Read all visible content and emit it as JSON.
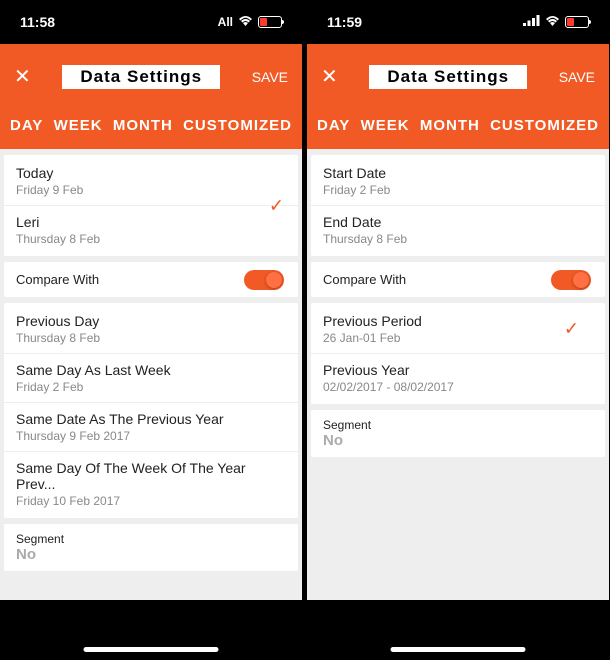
{
  "accent": "#f15a24",
  "left": {
    "status_time": "11:58",
    "carrier": "All",
    "header": {
      "title": "Data Settings",
      "save": "SAVE"
    },
    "tabs": [
      "DAY",
      "WEEK",
      "MONTH",
      "CUSTOMIZED"
    ],
    "options": [
      {
        "title": "Today",
        "sub": "Friday 9 Feb",
        "selected": true
      },
      {
        "title": "Leri",
        "sub": "Thursday 8 Feb",
        "selected": false
      }
    ],
    "compare_label": "Compare With",
    "compare_on": true,
    "compare_options": [
      {
        "title": "Previous Day",
        "sub": "Thursday 8 Feb"
      },
      {
        "title": "Same Day As Last Week",
        "sub": "Friday 2 Feb"
      },
      {
        "title": "Same Date As The Previous Year",
        "sub": "Thursday 9 Feb 2017"
      },
      {
        "title": "Same Day Of The Week Of The Year Prev...",
        "sub": "Friday 10 Feb 2017"
      }
    ],
    "segment": {
      "label": "Segment",
      "value": "No"
    }
  },
  "right": {
    "status_time": "11:59",
    "header": {
      "title": "Data Settings",
      "save": "SAVE"
    },
    "tabs": [
      "DAY",
      "WEEK",
      "MONTH",
      "CUSTOMIZED"
    ],
    "date_range": [
      {
        "title": "Start Date",
        "sub": "Friday 2 Feb"
      },
      {
        "title": "End Date",
        "sub": "Thursday 8 Feb"
      }
    ],
    "compare_label": "Compare With",
    "compare_on": true,
    "compare_options": [
      {
        "title": "Previous Period",
        "sub": "26 Jan-01 Feb",
        "selected": true
      },
      {
        "title": "Previous Year",
        "sub": "02/02/2017 - 08/02/2017",
        "selected": false
      }
    ],
    "segment": {
      "label": "Segment",
      "value": "No"
    }
  }
}
